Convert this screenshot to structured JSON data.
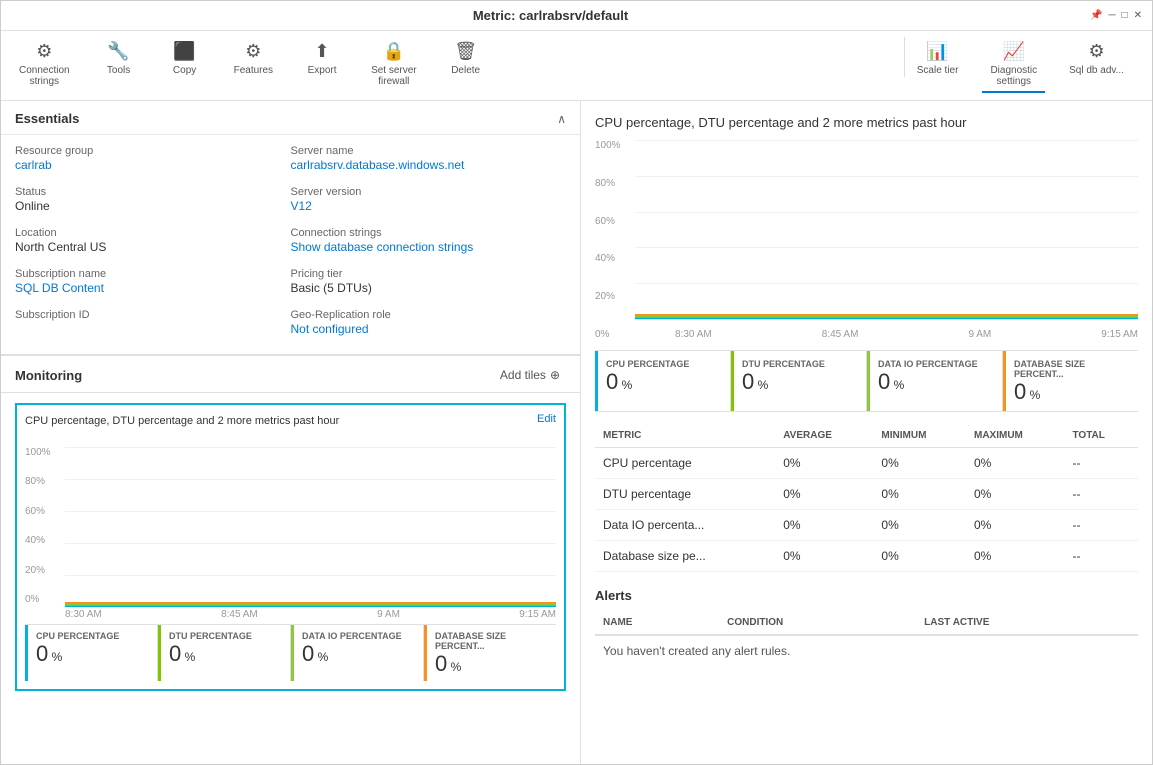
{
  "window": {
    "title": "Metric: carlrabsrv/default",
    "subtitle": "carlrabsrv/default"
  },
  "titlebar": {
    "pin_icon": "📌",
    "minimize_icon": "─",
    "maximize_icon": "□",
    "close_icon": "✕"
  },
  "toolbar_left": {
    "items": [
      {
        "id": "connection-strings",
        "icon": "⚙",
        "label": "Connection\nstrings"
      },
      {
        "id": "tools",
        "icon": "🔧",
        "label": "Tools"
      },
      {
        "id": "copy",
        "icon": "⬛",
        "label": "Copy"
      },
      {
        "id": "features",
        "icon": "⚙",
        "label": "Features"
      },
      {
        "id": "export",
        "icon": "⬆",
        "label": "Export"
      },
      {
        "id": "set-server-firewall",
        "icon": "🔒",
        "label": "Set server\nfirewall"
      },
      {
        "id": "delete",
        "icon": "🗑",
        "label": "Delete"
      }
    ]
  },
  "toolbar_right": {
    "items": [
      {
        "id": "scale",
        "icon": "📊",
        "label": "Scale tier"
      },
      {
        "id": "diagnostic",
        "icon": "📈",
        "label": "Diagnostic\nsettings",
        "active": true
      },
      {
        "id": "advisor",
        "icon": "⚙",
        "label": "Sql db adv..."
      }
    ]
  },
  "essentials": {
    "title": "Essentials",
    "fields_left": [
      {
        "id": "resource-group-label",
        "label": "Resource group",
        "value": "carlrab",
        "is_link": true
      },
      {
        "id": "status-label",
        "label": "Status",
        "value": "Online",
        "is_link": false
      },
      {
        "id": "location-label",
        "label": "Location",
        "value": "North Central US",
        "is_link": false
      },
      {
        "id": "subscription-name-label",
        "label": "Subscription name",
        "value": "SQL DB Content",
        "is_link": true
      },
      {
        "id": "subscription-id-label",
        "label": "Subscription ID",
        "value": "",
        "is_link": false
      }
    ],
    "fields_right": [
      {
        "id": "server-name-label",
        "label": "Server name",
        "value": "carlrabsrv.database.windows.net",
        "is_link": true
      },
      {
        "id": "server-version-label",
        "label": "Server version",
        "value": "V12",
        "is_link": true
      },
      {
        "id": "connection-strings-label",
        "label": "Connection strings",
        "value": "Show database connection strings",
        "is_link": true
      },
      {
        "id": "pricing-tier-label",
        "label": "Pricing tier",
        "value": "Basic (5 DTUs)",
        "is_link": false
      },
      {
        "id": "geo-replication-label",
        "label": "Geo-Replication role",
        "value": "Not configured",
        "is_link": true
      }
    ]
  },
  "monitoring": {
    "title": "Monitoring",
    "add_tiles_label": "Add tiles",
    "chart_title": "CPU percentage, DTU percentage and 2 more metrics past hour",
    "edit_label": "Edit",
    "y_axis": [
      "100%",
      "80%",
      "60%",
      "40%",
      "20%",
      "0%"
    ],
    "x_axis": [
      "8:30 AM",
      "8:45 AM",
      "9 AM",
      "9:15 AM"
    ],
    "metric_tiles": [
      {
        "id": "cpu-pct",
        "color": "blue",
        "name": "CPU PERCENTAGE",
        "value": "0",
        "unit": "%"
      },
      {
        "id": "dtu-pct",
        "color": "green",
        "name": "DTU PERCENTAGE",
        "value": "0",
        "unit": "%"
      },
      {
        "id": "data-io-pct",
        "color": "lime",
        "name": "DATA IO PERCENTAGE",
        "value": "0",
        "unit": "%"
      },
      {
        "id": "db-size-pct",
        "color": "orange",
        "name": "DATABASE SIZE PERCENT...",
        "value": "0",
        "unit": "%"
      }
    ]
  },
  "right_panel": {
    "chart_title": "CPU percentage, DTU percentage and 2 more metrics past hour",
    "y_axis": [
      "100%",
      "80%",
      "60%",
      "40%",
      "20%",
      "0%"
    ],
    "x_axis": [
      "8:30 AM",
      "8:45 AM",
      "9 AM",
      "9:15 AM"
    ],
    "metric_tiles": [
      {
        "id": "r-cpu-pct",
        "color": "blue",
        "name": "CPU PERCENTAGE",
        "value": "0",
        "unit": "%"
      },
      {
        "id": "r-dtu-pct",
        "color": "green",
        "name": "DTU PERCENTAGE",
        "value": "0",
        "unit": "%"
      },
      {
        "id": "r-data-io-pct",
        "color": "lime",
        "name": "DATA IO PERCENTAGE",
        "value": "0",
        "unit": "%"
      },
      {
        "id": "r-db-size-pct",
        "color": "orange",
        "name": "DATABASE SIZE PERCENT...",
        "value": "0",
        "unit": "%"
      }
    ],
    "table": {
      "headers": [
        "METRIC",
        "AVERAGE",
        "MINIMUM",
        "MAXIMUM",
        "TOTAL"
      ],
      "rows": [
        {
          "metric": "CPU percentage",
          "average": "0%",
          "minimum": "0%",
          "maximum": "0%",
          "total": "--"
        },
        {
          "metric": "DTU percentage",
          "average": "0%",
          "minimum": "0%",
          "maximum": "0%",
          "total": "--"
        },
        {
          "metric": "Data IO percenta...",
          "average": "0%",
          "minimum": "0%",
          "maximum": "0%",
          "total": "--"
        },
        {
          "metric": "Database size pe...",
          "average": "0%",
          "minimum": "0%",
          "maximum": "0%",
          "total": "--"
        }
      ]
    },
    "alerts": {
      "title": "Alerts",
      "headers": [
        "NAME",
        "CONDITION",
        "LAST ACTIVE"
      ],
      "empty_message": "You haven't created any alert rules."
    }
  }
}
